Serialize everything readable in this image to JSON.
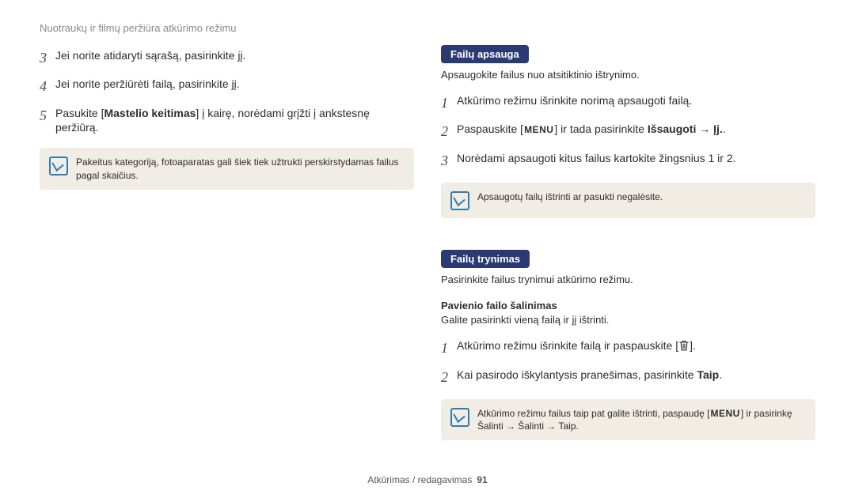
{
  "header": "Nuotraukų ir filmų peržiūra atkūrimo režimu",
  "left": {
    "step3": "Jei norite atidaryti sąrašą, pasirinkite jį.",
    "step4": "Jei norite peržiūrėti failą, pasirinkite jį.",
    "step5_a": "Pasukite [",
    "step5_bold": "Mastelio keitimas",
    "step5_b": "] į kairę, norėdami grįžti į ankstesnę peržiūrą.",
    "note1": "Pakeitus kategoriją, fotoaparatas gali šiek tiek užtrukti perskirstydamas failus pagal skaičius."
  },
  "right": {
    "sec1_title": "Failų apsauga",
    "sec1_desc": "Apsaugokite failus nuo atsitiktinio ištrynimo.",
    "s1_step1": "Atkūrimo režimu išrinkite norimą apsaugoti failą.",
    "s1_step2_a": "Paspauskite [",
    "s1_step2_b": "] ir tada pasirinkite ",
    "s1_step2_bold1": "Išsaugoti",
    "s1_step2_arrow": " → ",
    "s1_step2_bold2": "Įj.",
    "s1_step2_c": ".",
    "s1_step3": "Norėdami apsaugoti kitus failus kartokite žingsnius 1 ir 2.",
    "s1_note": "Apsaugotų failų ištrinti ar pasukti negalėsite.",
    "sec2_title": "Failų trynimas",
    "sec2_desc": "Pasirinkite failus trynimui atkūrimo režimu.",
    "sec2_sub": "Pavienio failo šalinimas",
    "sec2_subdesc": "Galite pasirinkti vieną failą ir jį ištrinti.",
    "s2_step1_a": "Atkūrimo režimu išrinkite failą ir paspauskite [",
    "s2_step1_b": "].",
    "s2_step2_a": "Kai pasirodo iškylantysis pranešimas, pasirinkite ",
    "s2_step2_bold": "Taip",
    "s2_step2_b": ".",
    "s2_note_a": "Atkūrimo režimu failus taip pat galite ištrinti, paspaudę [",
    "s2_note_b": "] ir pasirinkę ",
    "s2_note_bold1": "Šalinti",
    "s2_note_arrow1": " → ",
    "s2_note_bold2": "Šalinti",
    "s2_note_arrow2": " → ",
    "s2_note_bold3": "Taip",
    "s2_note_c": "."
  },
  "menu_label": "MENU",
  "footer_text": "Atkūrimas / redagavimas",
  "page_number": "91"
}
